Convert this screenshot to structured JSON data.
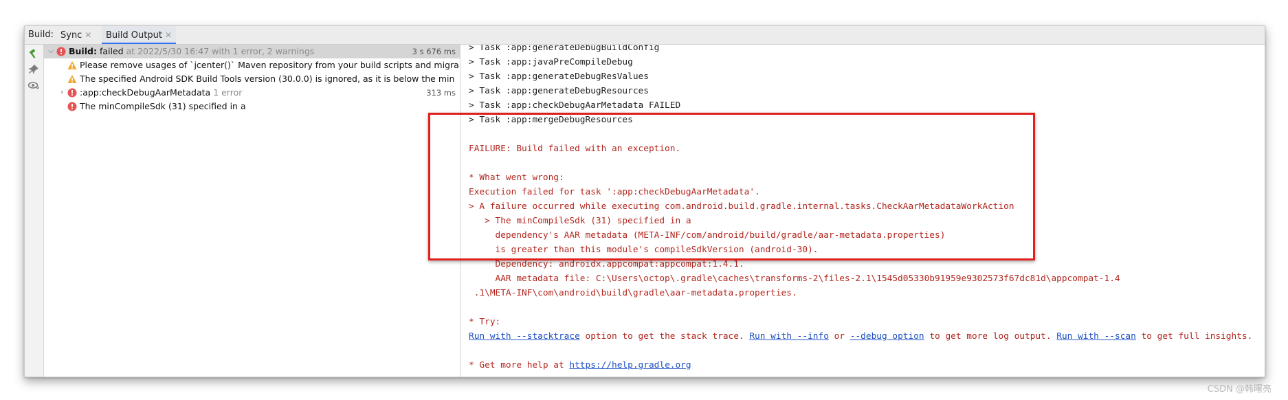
{
  "tabbar": {
    "title": "Build:",
    "tabs": [
      {
        "label": "Sync"
      },
      {
        "label": "Build Output"
      }
    ]
  },
  "toolbar_icons": [
    "hammer-icon",
    "pin-icon",
    "eye-icon"
  ],
  "tree": {
    "root": {
      "label_bold": "Build:",
      "label_status": "failed",
      "label_detail": "at 2022/5/30 16:47 with 1 error, 2 warnings",
      "time": "3 s 676 ms"
    },
    "warnings": [
      "Please remove usages of `jcenter()` Maven repository from your build scripts and migra",
      "The specified Android SDK Build Tools version (30.0.0) is ignored, as it is below the min"
    ],
    "task": {
      "label": ":app:checkDebugAarMetadata",
      "count": "1 error",
      "time": "313 ms"
    },
    "error": "The minCompileSdk (31) specified in a"
  },
  "console": {
    "task_lines": [
      "> Task :app:generateDebugBuildConfig",
      "> Task :app:javaPreCompileDebug",
      "> Task :app:generateDebugResValues",
      "> Task :app:generateDebugResources",
      "> Task :app:checkDebugAarMetadata FAILED",
      "> Task :app:mergeDebugResources"
    ],
    "failure_lines": [
      "FAILURE: Build failed with an exception.",
      "",
      "* What went wrong:",
      "Execution failed for task ':app:checkDebugAarMetadata'.",
      "> A failure occurred while executing com.android.build.gradle.internal.tasks.CheckAarMetadataWorkAction",
      "   > The minCompileSdk (31) specified in a",
      "     dependency's AAR metadata (META-INF/com/android/build/gradle/aar-metadata.properties)",
      "     is greater than this module's compileSdkVersion (android-30).",
      "     Dependency: androidx.appcompat:appcompat:1.4.1.",
      "     AAR metadata file: C:\\Users\\octop\\.gradle\\caches\\transforms-2\\files-2.1\\1545d05330b91959e9302573f67dc81d\\appcompat-1.4",
      " .1\\META-INF\\com\\android\\build\\gradle\\aar-metadata.properties."
    ],
    "try_label": "* Try:",
    "try_line": {
      "link1": "Run with --stacktrace",
      "text1": " option to get the stack trace. ",
      "link2": "Run with --info",
      "text2": " or ",
      "link3": "--debug option",
      "text3": " to get more log output. ",
      "link4": "Run with --scan",
      "text4": " to get full insights."
    },
    "help_prefix": "* Get more help at ",
    "help_link": "https://help.gradle.org"
  },
  "watermark": "CSDN @韩曙亮",
  "colors": {
    "error": "#b3261e",
    "link": "#1c4fc4",
    "highlight": "#e0201c"
  }
}
